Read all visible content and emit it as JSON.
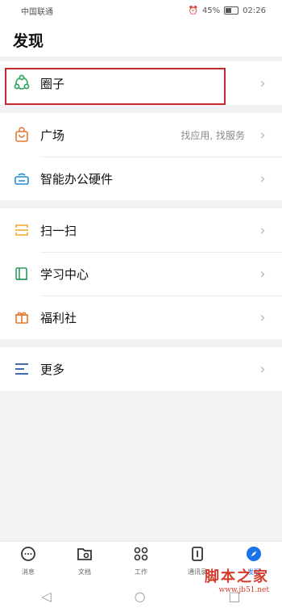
{
  "status": {
    "carrier": "中国联通",
    "battery": "45%",
    "time": "02:26"
  },
  "header": {
    "title": "发现"
  },
  "groups": [
    [
      {
        "label": "圈子",
        "sub": "",
        "icon": "circle-icon",
        "color": "#28a35b"
      }
    ],
    [
      {
        "label": "广场",
        "sub": "找应用, 找服务",
        "icon": "shopping-bag-icon",
        "color": "#e6782d"
      },
      {
        "label": "智能办公硬件",
        "sub": "",
        "icon": "smart-device-icon",
        "color": "#1f8ed6"
      }
    ],
    [
      {
        "label": "扫一扫",
        "sub": "",
        "icon": "scan-icon",
        "color": "#f1a82a"
      },
      {
        "label": "学习中心",
        "sub": "",
        "icon": "book-icon",
        "color": "#2a9d5b"
      },
      {
        "label": "福利社",
        "sub": "",
        "icon": "gift-icon",
        "color": "#e6782d"
      }
    ],
    [
      {
        "label": "更多",
        "sub": "",
        "icon": "menu-icon",
        "color": "#2d5c9e"
      }
    ]
  ],
  "tabs": [
    {
      "label": "消息",
      "icon": "chat-icon"
    },
    {
      "label": "文档",
      "icon": "document-icon"
    },
    {
      "label": "工作",
      "icon": "grid-icon"
    },
    {
      "label": "通讯录",
      "icon": "contacts-icon"
    },
    {
      "label": "发现",
      "icon": "compass-icon",
      "active": true
    }
  ],
  "watermark": {
    "line1": "脚本之家",
    "line2": "www.jb51.net"
  }
}
